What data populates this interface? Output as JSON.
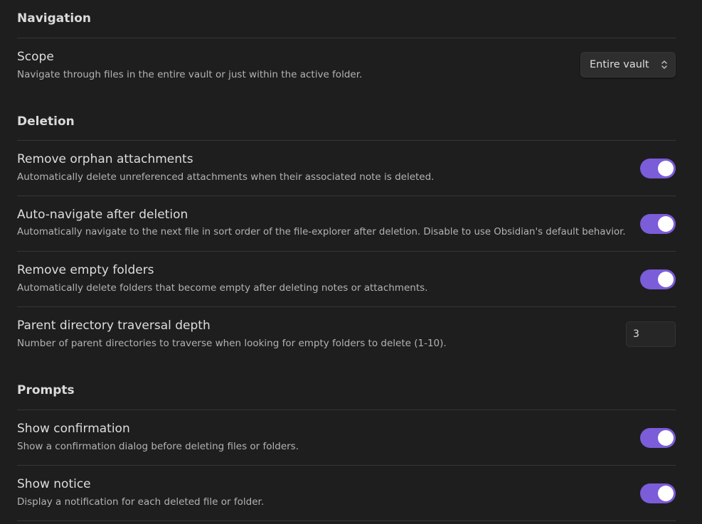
{
  "sections": {
    "navigation": {
      "heading": "Navigation",
      "scope": {
        "name": "Scope",
        "description": "Navigate through files in the entire vault or just within the active folder.",
        "value": "Entire vault",
        "icon": "chevron-up-down-icon"
      }
    },
    "deletion": {
      "heading": "Deletion",
      "remove_orphan": {
        "name": "Remove orphan attachments",
        "description": "Automatically delete unreferenced attachments when their associated note is deleted.",
        "enabled": true
      },
      "auto_navigate": {
        "name": "Auto-navigate after deletion",
        "description": "Automatically navigate to the next file in sort order of the file-explorer after deletion. Disable to use Obsidian's default behavior.",
        "enabled": true
      },
      "remove_empty_folders": {
        "name": "Remove empty folders",
        "description": "Automatically delete folders that become empty after deleting notes or attachments.",
        "enabled": true
      },
      "traversal_depth": {
        "name": "Parent directory traversal depth",
        "description": "Number of parent directories to traverse when looking for empty folders to delete (1-10).",
        "value": "3"
      }
    },
    "prompts": {
      "heading": "Prompts",
      "show_confirmation": {
        "name": "Show confirmation",
        "description": "Show a confirmation dialog before deleting files or folders.",
        "enabled": true
      },
      "show_notice": {
        "name": "Show notice",
        "description": "Display a notification for each deleted file or folder.",
        "enabled": true
      }
    }
  },
  "colors": {
    "background": "#1e1e1e",
    "accent": "#7b5cd9",
    "divider": "#363636"
  }
}
